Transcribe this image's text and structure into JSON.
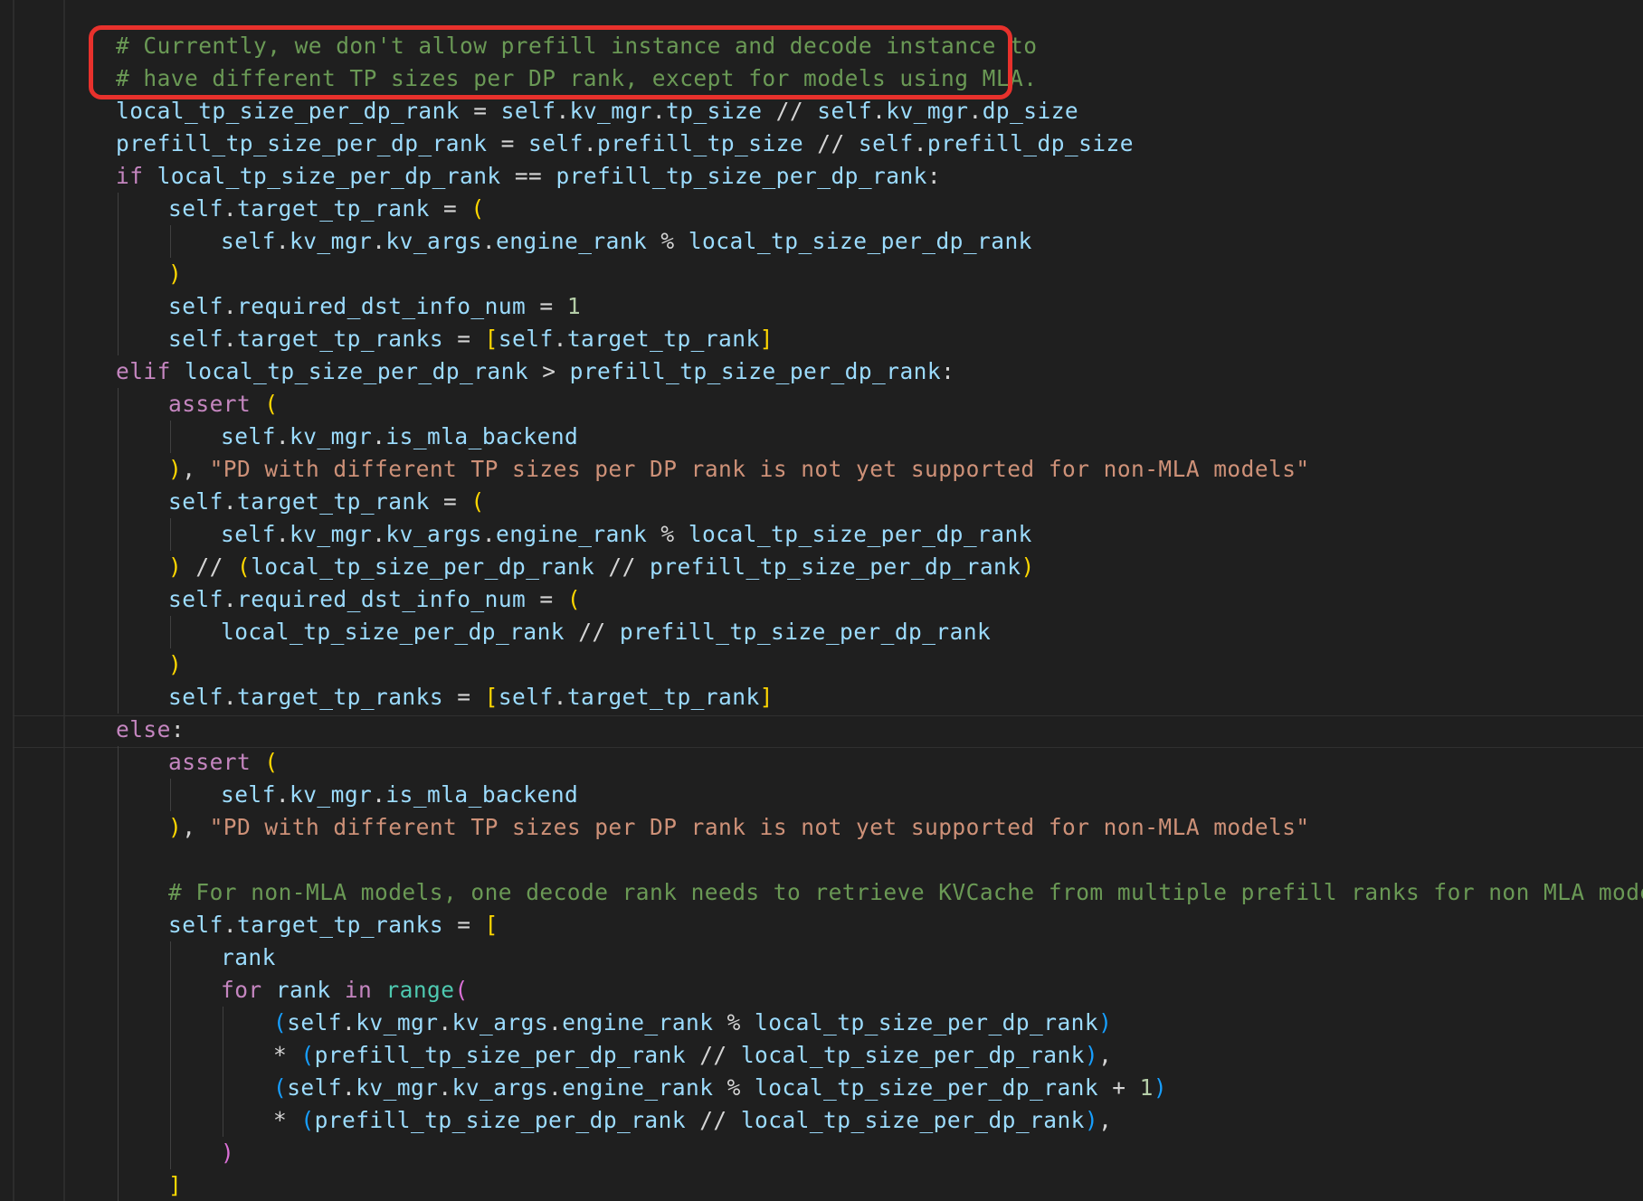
{
  "code": {
    "language": "python",
    "lines": [
      {
        "indent": 0,
        "tokens": [
          [
            "com",
            "# Currently, we don't allow prefill instance and decode instance to"
          ]
        ]
      },
      {
        "indent": 0,
        "tokens": [
          [
            "com",
            "# have different TP sizes per DP rank, except for models using MLA."
          ]
        ]
      },
      {
        "indent": 0,
        "tokens": [
          [
            "plain",
            "local_tp_size_per_dp_rank"
          ],
          [
            "op",
            " = "
          ],
          [
            "plain",
            "self"
          ],
          [
            "op",
            "."
          ],
          [
            "plain",
            "kv_mgr"
          ],
          [
            "op",
            "."
          ],
          [
            "plain",
            "tp_size"
          ],
          [
            "op",
            " // "
          ],
          [
            "plain",
            "self"
          ],
          [
            "op",
            "."
          ],
          [
            "plain",
            "kv_mgr"
          ],
          [
            "op",
            "."
          ],
          [
            "plain",
            "dp_size"
          ]
        ]
      },
      {
        "indent": 0,
        "tokens": [
          [
            "plain",
            "prefill_tp_size_per_dp_rank"
          ],
          [
            "op",
            " = "
          ],
          [
            "plain",
            "self"
          ],
          [
            "op",
            "."
          ],
          [
            "plain",
            "prefill_tp_size"
          ],
          [
            "op",
            " // "
          ],
          [
            "plain",
            "self"
          ],
          [
            "op",
            "."
          ],
          [
            "plain",
            "prefill_dp_size"
          ]
        ]
      },
      {
        "indent": 0,
        "tokens": [
          [
            "kw",
            "if"
          ],
          [
            "op",
            " "
          ],
          [
            "plain",
            "local_tp_size_per_dp_rank"
          ],
          [
            "op",
            " == "
          ],
          [
            "plain",
            "prefill_tp_size_per_dp_rank"
          ],
          [
            "op",
            ":"
          ]
        ]
      },
      {
        "indent": 1,
        "tokens": [
          [
            "plain",
            "self"
          ],
          [
            "op",
            "."
          ],
          [
            "plain",
            "target_tp_rank"
          ],
          [
            "op",
            " = "
          ],
          [
            "b1",
            "("
          ]
        ]
      },
      {
        "indent": 2,
        "tokens": [
          [
            "plain",
            "self"
          ],
          [
            "op",
            "."
          ],
          [
            "plain",
            "kv_mgr"
          ],
          [
            "op",
            "."
          ],
          [
            "plain",
            "kv_args"
          ],
          [
            "op",
            "."
          ],
          [
            "plain",
            "engine_rank"
          ],
          [
            "op",
            " % "
          ],
          [
            "plain",
            "local_tp_size_per_dp_rank"
          ]
        ]
      },
      {
        "indent": 1,
        "tokens": [
          [
            "b1",
            ")"
          ]
        ]
      },
      {
        "indent": 1,
        "tokens": [
          [
            "plain",
            "self"
          ],
          [
            "op",
            "."
          ],
          [
            "plain",
            "required_dst_info_num"
          ],
          [
            "op",
            " = "
          ],
          [
            "num",
            "1"
          ]
        ]
      },
      {
        "indent": 1,
        "tokens": [
          [
            "plain",
            "self"
          ],
          [
            "op",
            "."
          ],
          [
            "plain",
            "target_tp_ranks"
          ],
          [
            "op",
            " = "
          ],
          [
            "b1",
            "["
          ],
          [
            "plain",
            "self"
          ],
          [
            "op",
            "."
          ],
          [
            "plain",
            "target_tp_rank"
          ],
          [
            "b1",
            "]"
          ]
        ]
      },
      {
        "indent": 0,
        "tokens": [
          [
            "kw",
            "elif"
          ],
          [
            "op",
            " "
          ],
          [
            "plain",
            "local_tp_size_per_dp_rank"
          ],
          [
            "op",
            " > "
          ],
          [
            "plain",
            "prefill_tp_size_per_dp_rank"
          ],
          [
            "op",
            ":"
          ]
        ]
      },
      {
        "indent": 1,
        "tokens": [
          [
            "kw",
            "assert"
          ],
          [
            "op",
            " "
          ],
          [
            "b1",
            "("
          ]
        ]
      },
      {
        "indent": 2,
        "tokens": [
          [
            "plain",
            "self"
          ],
          [
            "op",
            "."
          ],
          [
            "plain",
            "kv_mgr"
          ],
          [
            "op",
            "."
          ],
          [
            "plain",
            "is_mla_backend"
          ]
        ]
      },
      {
        "indent": 1,
        "tokens": [
          [
            "b1",
            ")"
          ],
          [
            "op",
            ", "
          ],
          [
            "str",
            "\"PD with different TP sizes per DP rank is not yet supported for non-MLA models\""
          ]
        ]
      },
      {
        "indent": 1,
        "tokens": [
          [
            "plain",
            "self"
          ],
          [
            "op",
            "."
          ],
          [
            "plain",
            "target_tp_rank"
          ],
          [
            "op",
            " = "
          ],
          [
            "b1",
            "("
          ]
        ]
      },
      {
        "indent": 2,
        "tokens": [
          [
            "plain",
            "self"
          ],
          [
            "op",
            "."
          ],
          [
            "plain",
            "kv_mgr"
          ],
          [
            "op",
            "."
          ],
          [
            "plain",
            "kv_args"
          ],
          [
            "op",
            "."
          ],
          [
            "plain",
            "engine_rank"
          ],
          [
            "op",
            " % "
          ],
          [
            "plain",
            "local_tp_size_per_dp_rank"
          ]
        ]
      },
      {
        "indent": 1,
        "tokens": [
          [
            "b1",
            ")"
          ],
          [
            "op",
            " // "
          ],
          [
            "b1",
            "("
          ],
          [
            "plain",
            "local_tp_size_per_dp_rank"
          ],
          [
            "op",
            " // "
          ],
          [
            "plain",
            "prefill_tp_size_per_dp_rank"
          ],
          [
            "b1",
            ")"
          ]
        ]
      },
      {
        "indent": 1,
        "tokens": [
          [
            "plain",
            "self"
          ],
          [
            "op",
            "."
          ],
          [
            "plain",
            "required_dst_info_num"
          ],
          [
            "op",
            " = "
          ],
          [
            "b1",
            "("
          ]
        ]
      },
      {
        "indent": 2,
        "tokens": [
          [
            "plain",
            "local_tp_size_per_dp_rank"
          ],
          [
            "op",
            " // "
          ],
          [
            "plain",
            "prefill_tp_size_per_dp_rank"
          ]
        ]
      },
      {
        "indent": 1,
        "tokens": [
          [
            "b1",
            ")"
          ]
        ]
      },
      {
        "indent": 1,
        "tokens": [
          [
            "plain",
            "self"
          ],
          [
            "op",
            "."
          ],
          [
            "plain",
            "target_tp_ranks"
          ],
          [
            "op",
            " = "
          ],
          [
            "b1",
            "["
          ],
          [
            "plain",
            "self"
          ],
          [
            "op",
            "."
          ],
          [
            "plain",
            "target_tp_rank"
          ],
          [
            "b1",
            "]"
          ]
        ]
      },
      {
        "indent": 0,
        "tokens": [
          [
            "kw",
            "else"
          ],
          [
            "op",
            ":"
          ]
        ]
      },
      {
        "indent": 1,
        "tokens": [
          [
            "kw",
            "assert"
          ],
          [
            "op",
            " "
          ],
          [
            "b1",
            "("
          ]
        ]
      },
      {
        "indent": 2,
        "tokens": [
          [
            "plain",
            "self"
          ],
          [
            "op",
            "."
          ],
          [
            "plain",
            "kv_mgr"
          ],
          [
            "op",
            "."
          ],
          [
            "plain",
            "is_mla_backend"
          ]
        ]
      },
      {
        "indent": 1,
        "tokens": [
          [
            "b1",
            ")"
          ],
          [
            "op",
            ", "
          ],
          [
            "str",
            "\"PD with different TP sizes per DP rank is not yet supported for non-MLA models\""
          ]
        ]
      },
      {
        "indent": 0,
        "tokens": []
      },
      {
        "indent": 1,
        "tokens": [
          [
            "com",
            "# For non-MLA models, one decode rank needs to retrieve KVCache from multiple prefill ranks for non MLA models;"
          ]
        ]
      },
      {
        "indent": 1,
        "tokens": [
          [
            "plain",
            "self"
          ],
          [
            "op",
            "."
          ],
          [
            "plain",
            "target_tp_ranks"
          ],
          [
            "op",
            " = "
          ],
          [
            "b1",
            "["
          ]
        ]
      },
      {
        "indent": 2,
        "tokens": [
          [
            "plain",
            "rank"
          ]
        ]
      },
      {
        "indent": 2,
        "tokens": [
          [
            "kw",
            "for"
          ],
          [
            "op",
            " "
          ],
          [
            "plain",
            "rank"
          ],
          [
            "op",
            " "
          ],
          [
            "kw",
            "in"
          ],
          [
            "op",
            " "
          ],
          [
            "fn",
            "range"
          ],
          [
            "b2",
            "("
          ]
        ]
      },
      {
        "indent": 3,
        "tokens": [
          [
            "b3",
            "("
          ],
          [
            "plain",
            "self"
          ],
          [
            "op",
            "."
          ],
          [
            "plain",
            "kv_mgr"
          ],
          [
            "op",
            "."
          ],
          [
            "plain",
            "kv_args"
          ],
          [
            "op",
            "."
          ],
          [
            "plain",
            "engine_rank"
          ],
          [
            "op",
            " % "
          ],
          [
            "plain",
            "local_tp_size_per_dp_rank"
          ],
          [
            "b3",
            ")"
          ]
        ]
      },
      {
        "indent": 3,
        "tokens": [
          [
            "op",
            "* "
          ],
          [
            "b3",
            "("
          ],
          [
            "plain",
            "prefill_tp_size_per_dp_rank"
          ],
          [
            "op",
            " // "
          ],
          [
            "plain",
            "local_tp_size_per_dp_rank"
          ],
          [
            "b3",
            ")"
          ],
          [
            "op",
            ","
          ]
        ]
      },
      {
        "indent": 3,
        "tokens": [
          [
            "b3",
            "("
          ],
          [
            "plain",
            "self"
          ],
          [
            "op",
            "."
          ],
          [
            "plain",
            "kv_mgr"
          ],
          [
            "op",
            "."
          ],
          [
            "plain",
            "kv_args"
          ],
          [
            "op",
            "."
          ],
          [
            "plain",
            "engine_rank"
          ],
          [
            "op",
            " % "
          ],
          [
            "plain",
            "local_tp_size_per_dp_rank"
          ],
          [
            "op",
            " + "
          ],
          [
            "num",
            "1"
          ],
          [
            "b3",
            ")"
          ]
        ]
      },
      {
        "indent": 3,
        "tokens": [
          [
            "op",
            "* "
          ],
          [
            "b3",
            "("
          ],
          [
            "plain",
            "prefill_tp_size_per_dp_rank"
          ],
          [
            "op",
            " // "
          ],
          [
            "plain",
            "local_tp_size_per_dp_rank"
          ],
          [
            "b3",
            ")"
          ],
          [
            "op",
            ","
          ]
        ]
      },
      {
        "indent": 2,
        "tokens": [
          [
            "b2",
            ")"
          ]
        ]
      },
      {
        "indent": 1,
        "tokens": [
          [
            "b1",
            "]"
          ]
        ]
      }
    ]
  },
  "highlight": {
    "color": "#e8312c",
    "lines": [
      0,
      1
    ]
  }
}
